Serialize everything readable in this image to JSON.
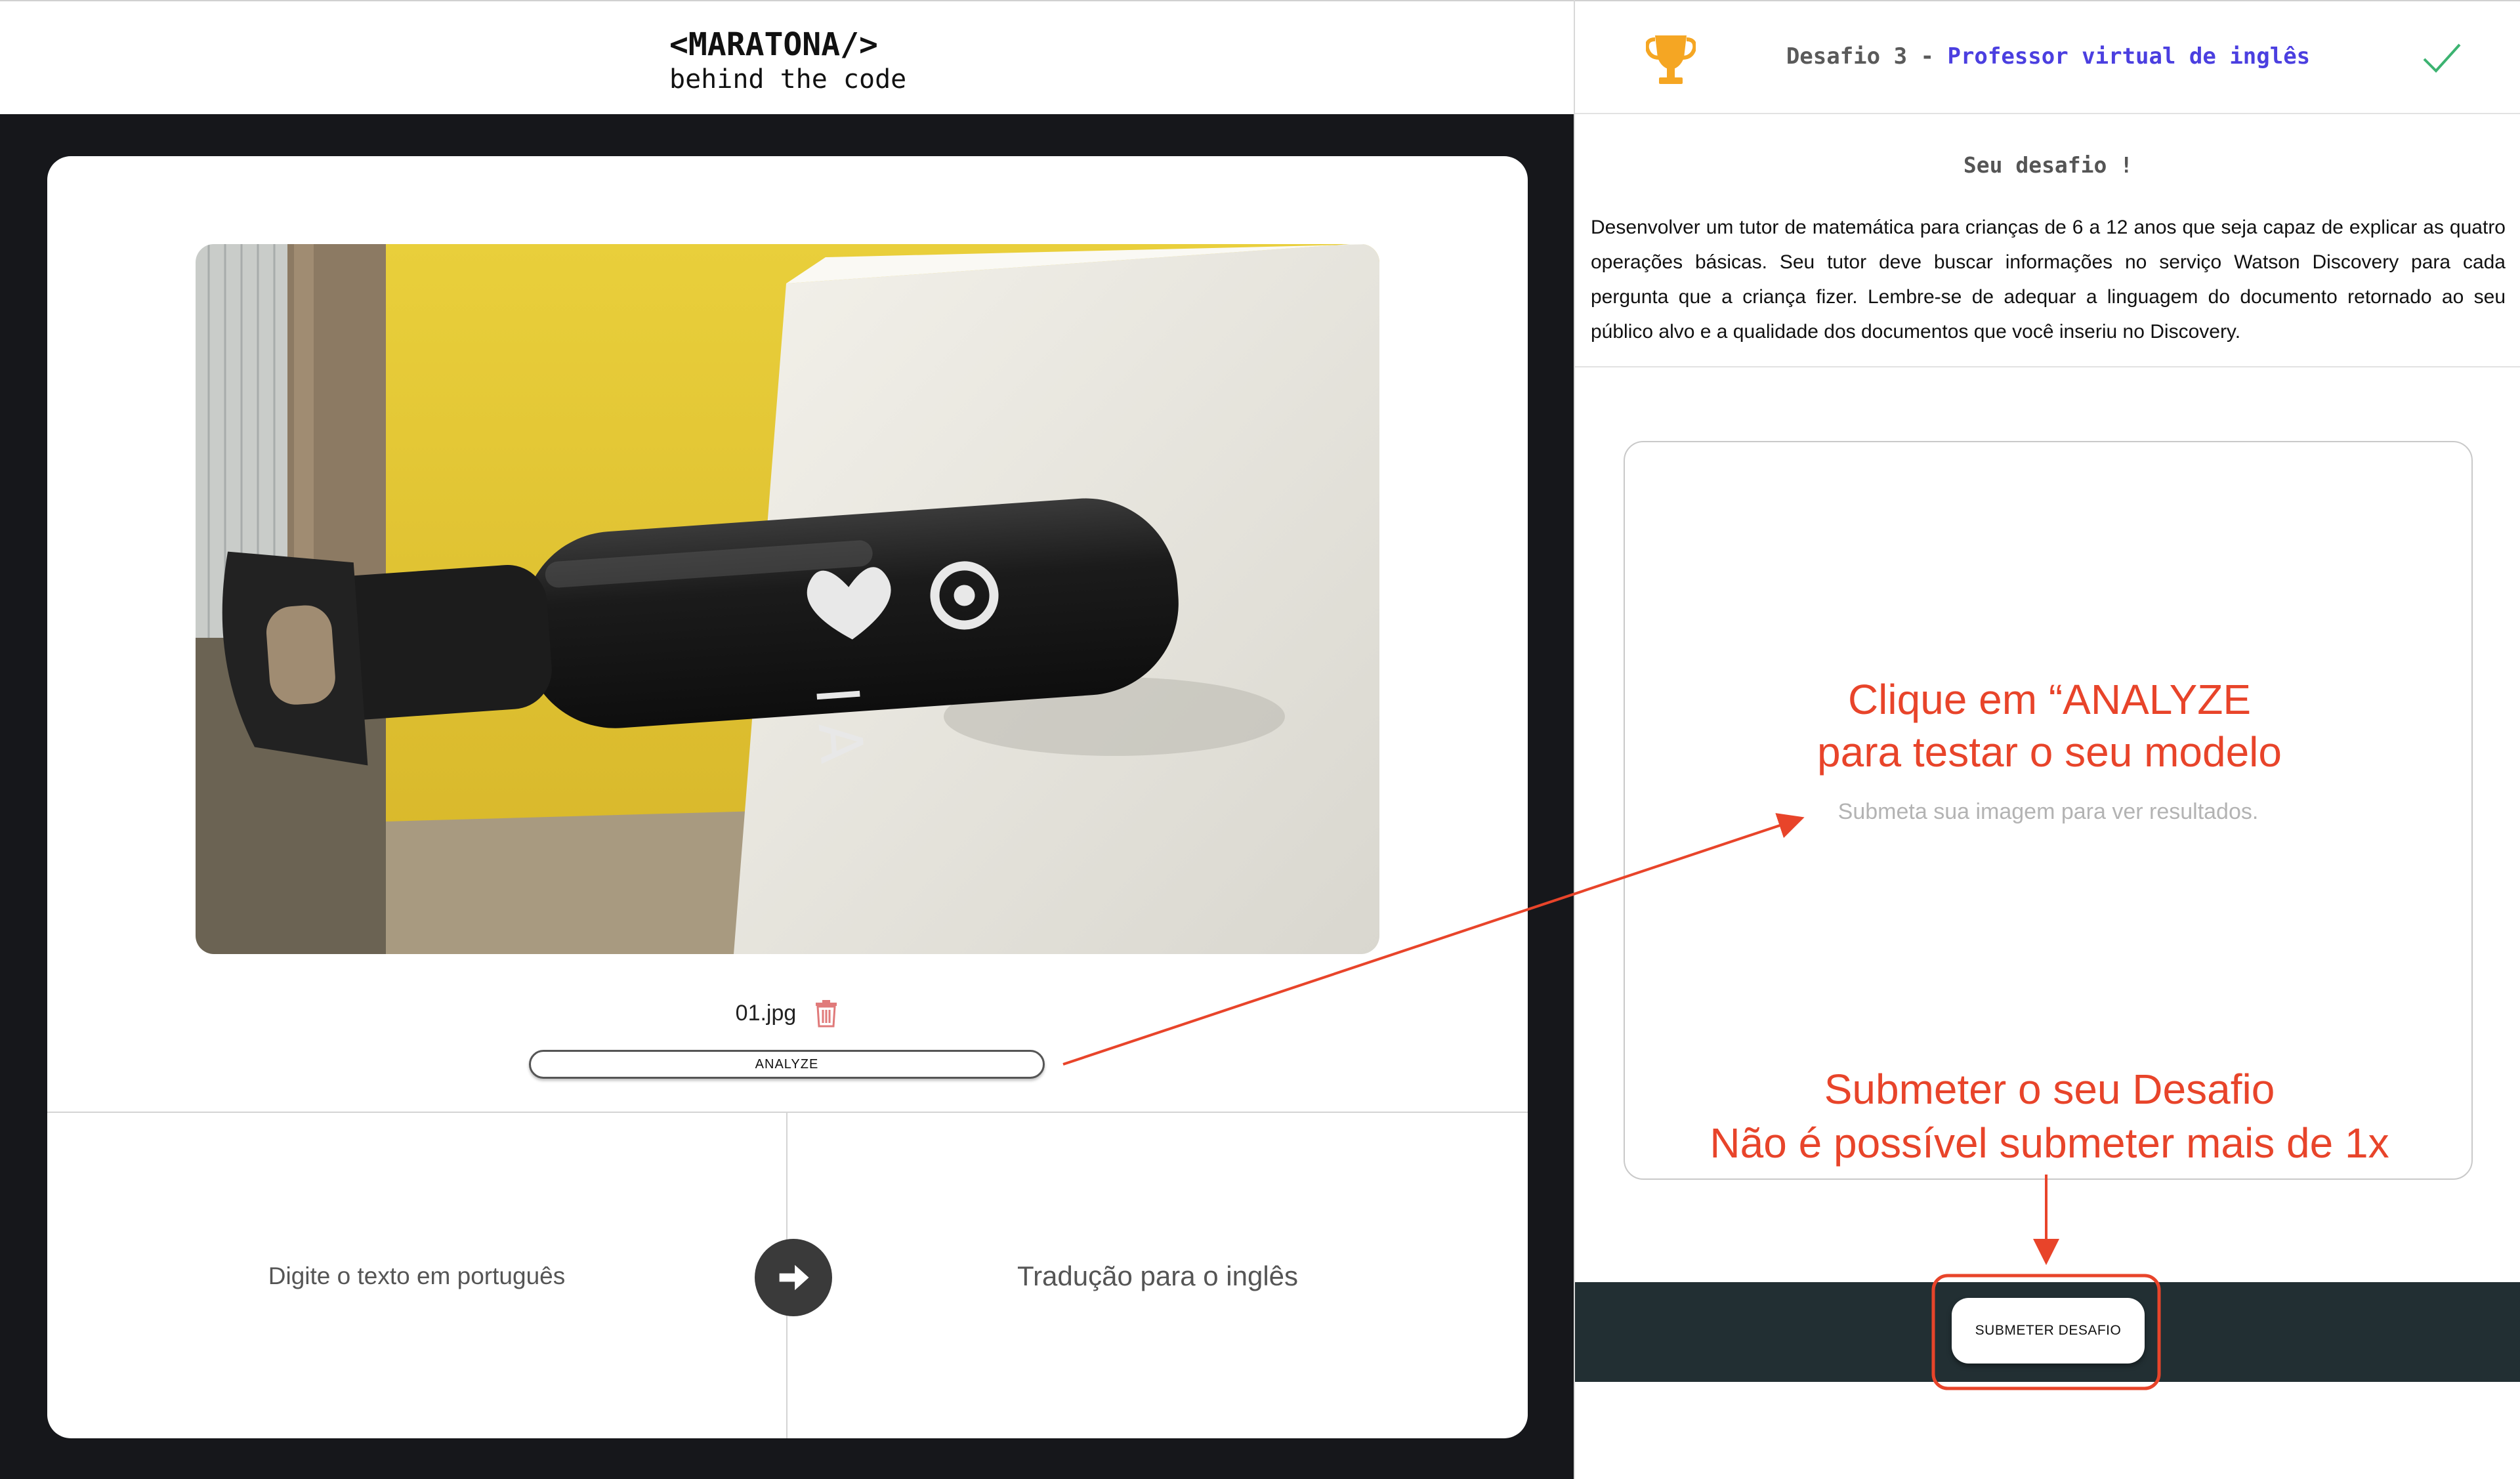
{
  "header": {
    "logo_main": "<MARATONA/>",
    "logo_sub": "behind the code"
  },
  "upload": {
    "file_name": "01.jpg",
    "analyze_label": "ANALYZE",
    "photo_text": "I A"
  },
  "translation": {
    "input_placeholder": "Digite o texto em português",
    "output_placeholder": "Tradução para o inglês"
  },
  "right_panel": {
    "challenge_prefix": "Desafio 3 - ",
    "challenge_name": "Professor virtual de inglês",
    "challenge_heading": "Seu desafio !",
    "challenge_description": "Desenvolver um tutor de matemática para crianças de 6 a 12 anos que seja capaz de explicar as quatro operações básicas. Seu tutor deve buscar informações no serviço Watson Discovery para cada pergunta que a criança fizer. Lembre-se de adequar a linguagem do documento retornado ao seu público alvo e a qualidade dos documentos que você inseriu no Discovery.",
    "results_placeholder": "Submeta sua imagem para ver resultados.",
    "submit_label": "SUBMETER DESAFIO"
  },
  "annotations": {
    "analyze_hint_line1": "Clique em “ANALYZE",
    "analyze_hint_line2": "para testar o seu modelo",
    "submit_hint_line1": "Submeter o seu Desafio",
    "submit_hint_line2": "Não é possível submeter mais de 1x"
  },
  "colors": {
    "accent_purple": "#4b3fe0",
    "annotation_red": "#e8442a",
    "trophy_gold": "#f5a623",
    "check_green": "#3cb371",
    "submit_bar": "#222f33",
    "page_dark": "#16171b"
  },
  "icons": {
    "trophy": "trophy-icon",
    "check": "check-icon",
    "trash": "trash-icon",
    "arrow": "arrow-right-icon"
  }
}
